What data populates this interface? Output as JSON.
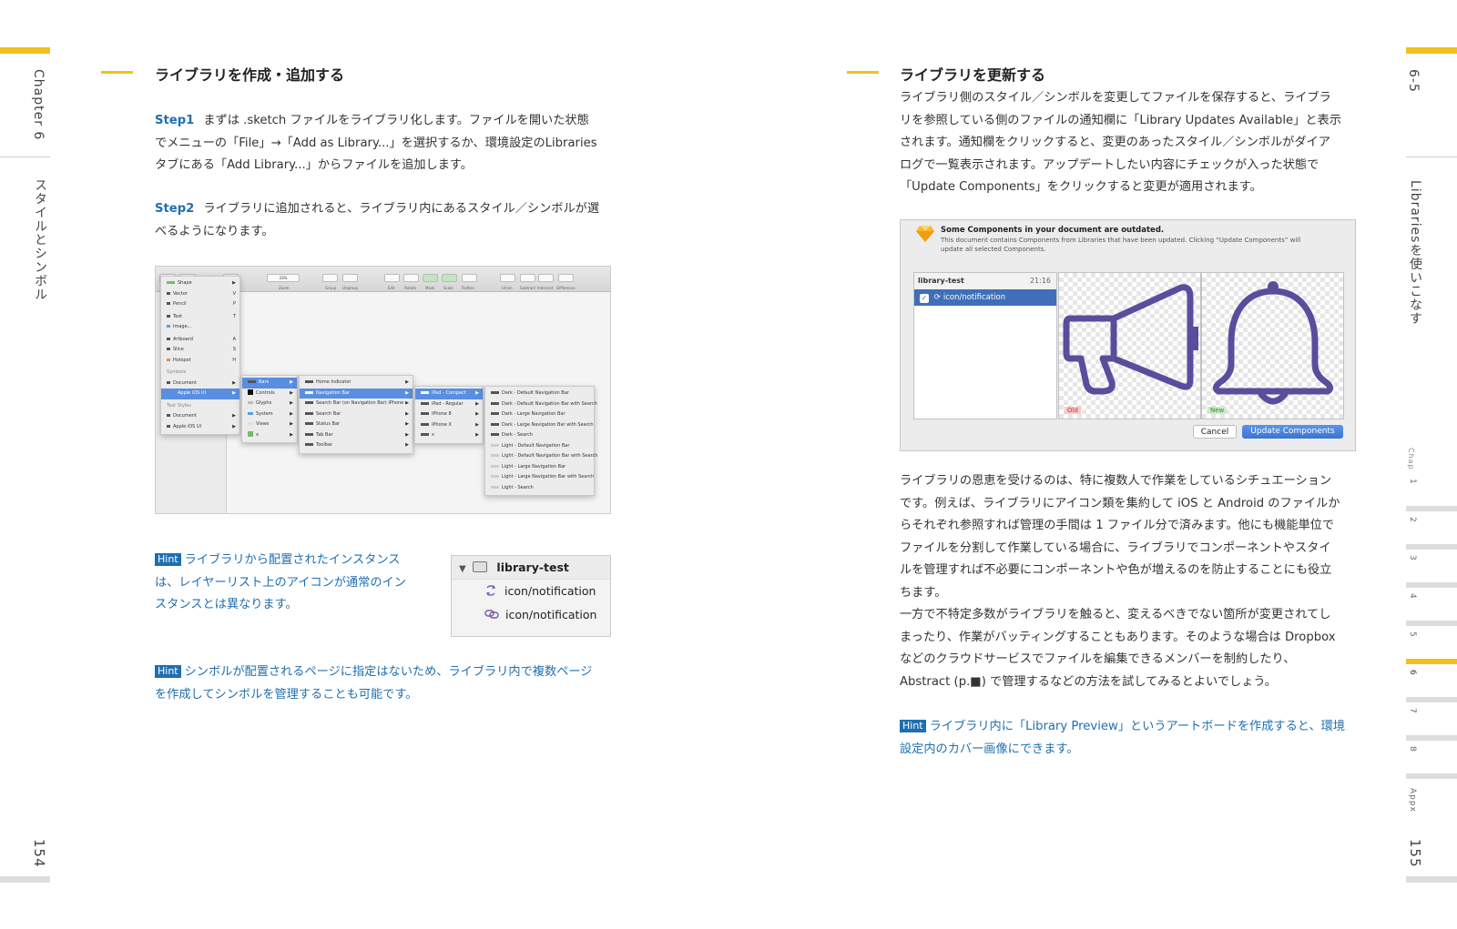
{
  "left_page": {
    "chapter_label": "Chapter 6",
    "chapter_title": "スタイルとシンボル",
    "page_number": "154",
    "heading": "ライブラリを作成・追加する",
    "step1": {
      "label": "Step1",
      "lines": [
        "まずは .sketch ファイルをライブラリ化します。ファイルを開いた状態",
        "でメニューの「File」→「Add as Library...」を選択するか、環境設定のLibraries",
        "タブにある「Add Library...」からファイルを追加します。"
      ]
    },
    "step2": {
      "label": "Step2",
      "lines": [
        "ライブラリに追加されると、ライブラリ内にあるスタイル／シンボルが選",
        "べるようになります。"
      ]
    },
    "sketch_screenshot": {
      "toolbar": {
        "zoom_value": "33%",
        "zoom_label": "Zoom",
        "labels": [
          "Group",
          "Ungroup",
          "Edit",
          "Rotate",
          "Mask",
          "Scale",
          "Flatten",
          "Union",
          "Subtract",
          "Intersect",
          "Difference"
        ]
      },
      "insert_menu": [
        "Shape",
        "Vector",
        "Pencil",
        "Text",
        "Image...",
        "Artboard",
        "Slice",
        "Hotspot",
        "Symbols",
        "Document",
        "Apple iOS UI",
        "Text Styles",
        "Document",
        "Apple iOS UI"
      ],
      "shortcuts": [
        "V",
        "P",
        "T",
        "A",
        "S",
        "H"
      ],
      "submenu_1": [
        "Bars",
        "Controls",
        "Glyphs",
        "System",
        "Views",
        "x"
      ],
      "submenu_2": [
        "Home Indicator",
        "Navigation Bar",
        "Search Bar (on Navigation Bar) iPhone",
        "Search Bar",
        "Status Bar",
        "Tab Bar",
        "Toolbar"
      ],
      "submenu_3": [
        "iPad - Compact",
        "iPad - Regular",
        "iPhone 8",
        "iPhone X",
        "x"
      ],
      "submenu_4": [
        "Dark - Default Navigation Bar",
        "Dark - Default Navigation Bar with Search",
        "Dark - Large Navigation Bar",
        "Dark - Large Navigation Bar with Search",
        "Dark - Search",
        "Light - Default Navigation Bar",
        "Light - Default Navigation Bar with Search",
        "Light - Large Navigation Bar",
        "Light - Large Navigation Bar with Search",
        "Light - Search"
      ]
    },
    "hint1": {
      "badge": "Hint",
      "lines": [
        "ライブラリから配置されたインスタンス",
        "は、レイヤーリスト上のアイコンが通常のイン",
        "スタンスとは異なります。"
      ]
    },
    "layer_panel": {
      "group": "library-test",
      "items": [
        "icon/notification",
        "icon/notification"
      ]
    },
    "hint2": {
      "badge": "Hint",
      "lines": [
        "シンボルが配置されるページに指定はないため、ライブラリ内で複数ページ",
        "を作成してシンボルを管理することも可能です。"
      ]
    }
  },
  "right_page": {
    "section_label": "6-5",
    "section_title": "Librariesを使いこなす",
    "page_number": "155",
    "heading": "ライブラリを更新する",
    "para1": [
      "ライブラリ側のスタイル／シンボルを変更してファイルを保存すると、ライブラ",
      "リを参照している側のファイルの通知欄に「Library Updates Available」と表示",
      "されます。通知欄をクリックすると、変更のあったスタイル／シンボルがダイア",
      "ログで一覧表示されます。アップデートしたい内容にチェックが入った状態で",
      "「Update Components」をクリックすると変更が適用されます。"
    ],
    "dialog": {
      "title": "Some Components in your document are outdated.",
      "message": [
        "This document contains Components from Libraries that have been updated. Clicking “Update Components” will",
        "update all selected Components."
      ],
      "library_name": "library-test",
      "library_time": "21:16",
      "item": "icon/notification",
      "old_label": "Old",
      "new_label": "New",
      "cancel": "Cancel",
      "update": "Update Components",
      "accent_color": "#5b4c9c"
    },
    "para2": [
      "ライブラリの恩恵を受けるのは、特に複数人で作業をしているシチュエーション",
      "です。例えば、ライブラリにアイコン類を集約して iOS と Android のファイルか",
      "らそれぞれ参照すれば管理の手間は 1 ファイル分で済みます。他にも機能単位で",
      "ファイルを分割して作業している場合に、ライブラリでコンポーネントやスタイ",
      "ルを管理すれば不必要にコンポーネントや色が増えるのを防止することにも役立",
      "ちます。",
      "一方で不特定多数がライブラリを触ると、変えるべきでない箇所が変更されてし",
      "まったり、作業がバッティングすることもあります。そのような場合は Dropbox",
      "などのクラウドサービスでファイルを編集できるメンバーを制約したり、",
      "Abstract (p.■) で管理するなどの方法を試してみるとよいでしょう。"
    ],
    "hint": {
      "badge": "Hint",
      "lines": [
        "ライブラリ内に「Library Preview」というアートボードを作成すると、環境",
        "設定内のカバー画像にできます。"
      ]
    },
    "chapter_index": {
      "header": "Chap",
      "items": [
        "1",
        "2",
        "3",
        "4",
        "5",
        "6",
        "7",
        "8",
        "Appx"
      ],
      "active": "6"
    }
  },
  "colors": {
    "accent_yellow": "#f2c01e",
    "hint_blue": "#1f6fb0",
    "icon_purple": "#5b4c9c"
  }
}
